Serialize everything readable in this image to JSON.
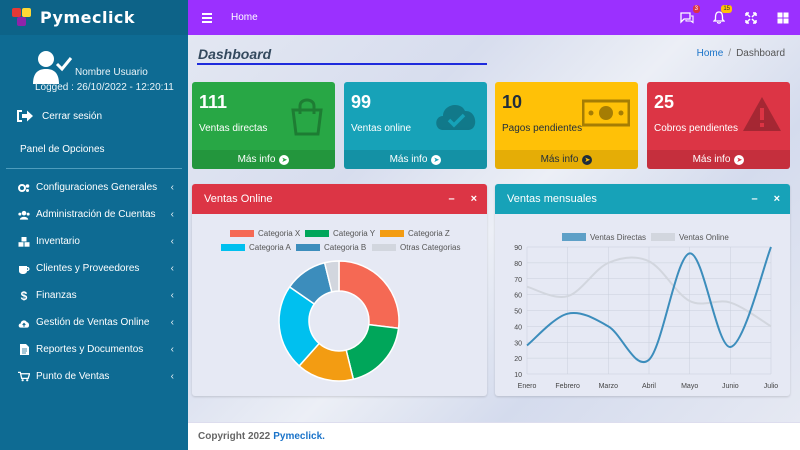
{
  "brand": {
    "name": "Pymeclick"
  },
  "user": {
    "name": "Nombre Usuario",
    "logged": "Logged : 26/10/2022 - 12:20:11"
  },
  "sidebar": {
    "logout_label": "Cerrar sesión",
    "panel_title": "Panel de Opciones",
    "items": [
      {
        "label": "Configuraciones Generales",
        "icon": "cogs-icon"
      },
      {
        "label": "Administración de Cuentas",
        "icon": "users-icon"
      },
      {
        "label": "Inventario",
        "icon": "cubes-icon"
      },
      {
        "label": "Clientes y Proveedores",
        "icon": "coffee-icon"
      },
      {
        "label": "Finanzas",
        "icon": "dollar-icon"
      },
      {
        "label": "Gestión de Ventas Online",
        "icon": "cloud-upload-icon"
      },
      {
        "label": "Reportes y Documentos",
        "icon": "file-icon"
      },
      {
        "label": "Punto de Ventas",
        "icon": "cart-icon"
      }
    ]
  },
  "topbar": {
    "home_label": "Home",
    "messages_count": "3",
    "notifications_count": "15"
  },
  "page": {
    "title": "Dashboard"
  },
  "breadcrumb": {
    "home": "Home",
    "separator": "/",
    "current": "Dashboard"
  },
  "boxes": [
    {
      "value": "111",
      "label": "Ventas directas",
      "footer": "Más info",
      "color": "#28a745",
      "icon": "shopping-bag-icon"
    },
    {
      "value": "99",
      "label": "Ventas online",
      "footer": "Más info",
      "color": "#17a2b8",
      "icon": "cloud-check-icon"
    },
    {
      "value": "10",
      "label": "Pagos pendientes",
      "footer": "Más info",
      "color": "#ffc107",
      "icon": "money-bill-icon"
    },
    {
      "value": "25",
      "label": "Cobros pendientes",
      "footer": "Más info",
      "color": "#dc3545",
      "icon": "warning-icon"
    }
  ],
  "cards": {
    "online": {
      "title": "Ventas Online",
      "minimize": "–",
      "close": "×",
      "color": "#dc3545"
    },
    "monthly": {
      "title": "Ventas mensuales",
      "minimize": "–",
      "close": "×",
      "color": "#17a2b8"
    }
  },
  "footer": {
    "text": "Copyright 2022",
    "brand": "Pymeclick."
  },
  "chart_data": [
    {
      "type": "pie",
      "subtype": "doughnut",
      "title": "",
      "legend_position": "top",
      "categories": [
        "Categoria X",
        "Categoria Y",
        "Categoria Z",
        "Categoria A",
        "Categoria B",
        "Otras Categorias"
      ],
      "values": [
        700,
        500,
        400,
        600,
        300,
        100
      ],
      "colors": [
        "#f56954",
        "#00a65a",
        "#f39c12",
        "#00c0ef",
        "#3c8dbc",
        "#d2d6de"
      ]
    },
    {
      "type": "line",
      "title": "",
      "legend_position": "top",
      "x": [
        "Enero",
        "Febrero",
        "Marzo",
        "Abril",
        "Mayo",
        "Junio",
        "Julio"
      ],
      "ylim": [
        10,
        90
      ],
      "yticks": [
        10,
        20,
        30,
        40,
        50,
        60,
        70,
        80,
        90
      ],
      "grid": true,
      "series": [
        {
          "name": "Ventas Directas",
          "values": [
            28,
            48,
            40,
            19,
            86,
            27,
            90
          ],
          "color": "#3c8dbc"
        },
        {
          "name": "Ventas Online",
          "values": [
            65,
            59,
            80,
            81,
            56,
            55,
            40
          ],
          "color": "#d2d6de"
        }
      ]
    }
  ]
}
